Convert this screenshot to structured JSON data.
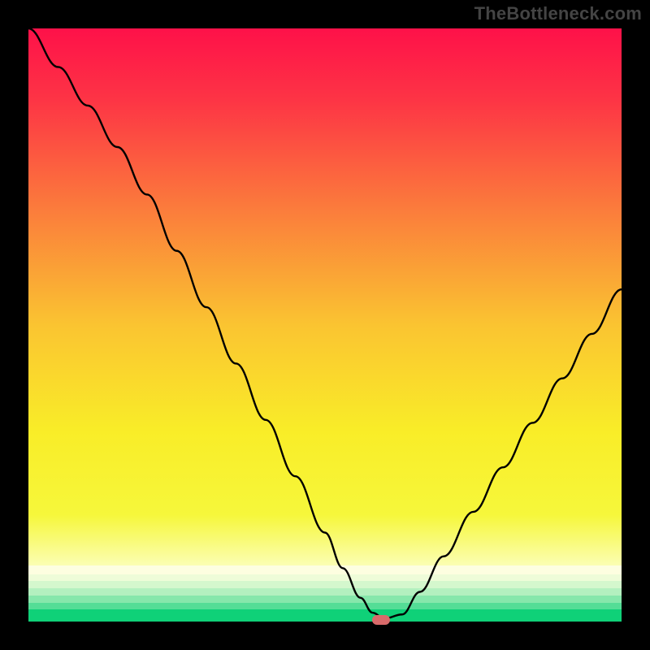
{
  "watermark": "TheBottleneck.com",
  "chart_data": {
    "type": "line",
    "title": "",
    "xlabel": "",
    "ylabel": "",
    "x": [
      0.0,
      0.05,
      0.1,
      0.15,
      0.2,
      0.25,
      0.3,
      0.35,
      0.4,
      0.45,
      0.5,
      0.53,
      0.56,
      0.58,
      0.6,
      0.63,
      0.66,
      0.7,
      0.75,
      0.8,
      0.85,
      0.9,
      0.95,
      1.0
    ],
    "values": [
      1.0,
      0.935,
      0.87,
      0.8,
      0.72,
      0.625,
      0.53,
      0.435,
      0.34,
      0.245,
      0.15,
      0.09,
      0.04,
      0.015,
      0.005,
      0.012,
      0.05,
      0.11,
      0.185,
      0.26,
      0.335,
      0.41,
      0.485,
      0.56
    ],
    "xlim": [
      0,
      1
    ],
    "ylim": [
      0,
      1
    ],
    "marker": {
      "x": 0.595,
      "y": 0.003
    },
    "gradient_stops": [
      {
        "pos": 0.0,
        "color": "#fe1149"
      },
      {
        "pos": 0.12,
        "color": "#fd3445"
      },
      {
        "pos": 0.3,
        "color": "#fb7a3c"
      },
      {
        "pos": 0.5,
        "color": "#fac431"
      },
      {
        "pos": 0.68,
        "color": "#f9ed28"
      },
      {
        "pos": 0.82,
        "color": "#f6f73b"
      },
      {
        "pos": 0.905,
        "color": "#fbfeb2"
      },
      {
        "pos": 0.93,
        "color": "#dffac8"
      },
      {
        "pos": 0.955,
        "color": "#a7f0b9"
      },
      {
        "pos": 0.975,
        "color": "#4fdd92"
      },
      {
        "pos": 1.0,
        "color": "#0dcf75"
      }
    ]
  }
}
